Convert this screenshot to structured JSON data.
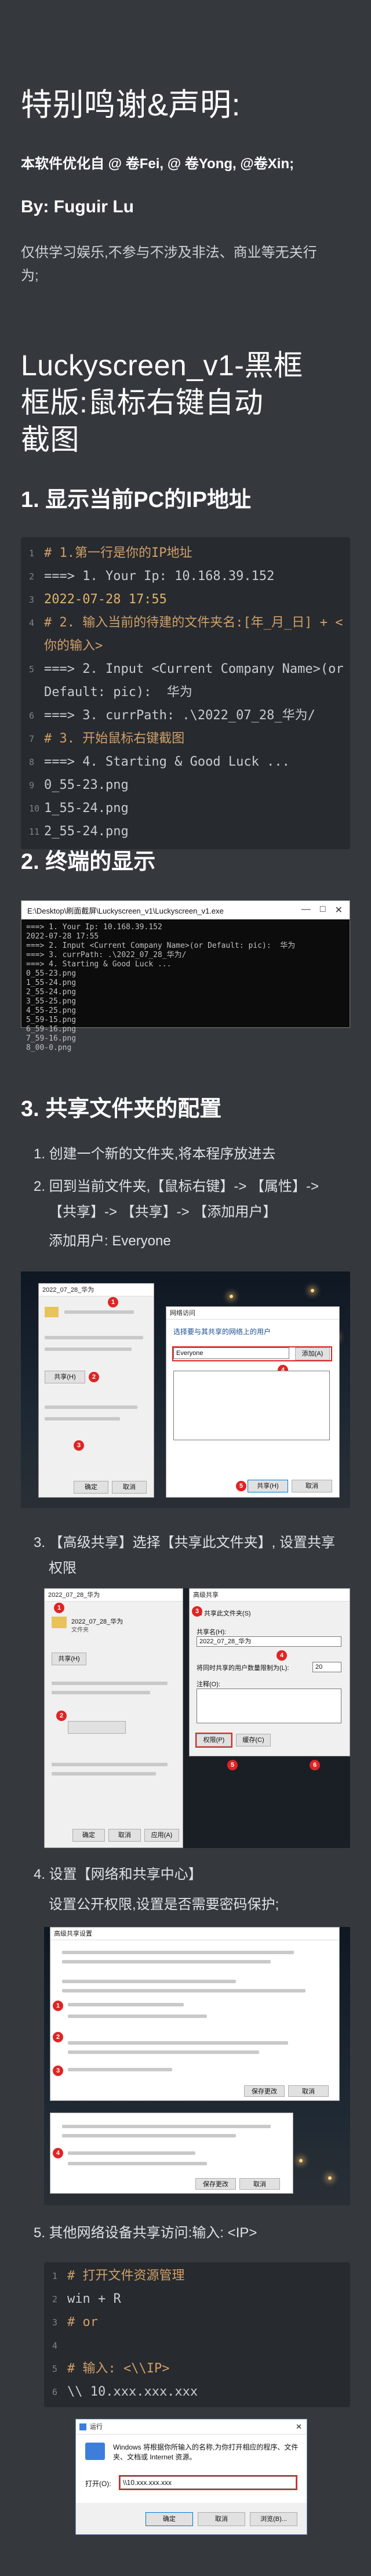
{
  "intro": {
    "title": "特别鸣谢&声明:",
    "optimized_by": "本软件优化自 @ 卷Fei, @ 卷Yong, @卷Xin;",
    "by": "By: Fuguir Lu",
    "disclaimer_line1": "仅供学习娱乐,不参与不涉及非法、商业等无关行",
    "disclaimer_line2": "为;"
  },
  "main": {
    "title_line1": "Luckyscreen_v1-黑框",
    "title_line2": "框版:鼠标右键自动",
    "title_line3": "截图"
  },
  "section1": {
    "heading": "1. 显示当前PC的IP地址",
    "code": [
      {
        "n": "1",
        "text": "# 1.第一行是你的IP地址",
        "kind": "comment"
      },
      {
        "n": "2",
        "text": "===> 1. Your Ip: 10.168.39.152",
        "kind": "plain"
      },
      {
        "n": "3",
        "text": "2022-07-28 17:55",
        "kind": "num"
      },
      {
        "n": "4",
        "text": "# 2. 输入当前的待建的文件夹名:[年_月_日] + < 你的输入>",
        "kind": "comment"
      },
      {
        "n": "5",
        "text": "===> 2. Input <Current Company Name>(or Default: pic):  华为",
        "kind": "plain"
      },
      {
        "n": "6",
        "text": "===> 3. currPath: .\\2022_07_28_华为/",
        "kind": "plain"
      },
      {
        "n": "7",
        "text": "# 3. 开始鼠标右键截图",
        "kind": "comment"
      },
      {
        "n": "8",
        "text": "===> 4. Starting & Good Luck ...",
        "kind": "plain"
      },
      {
        "n": "9",
        "text": "0_55-23.png",
        "kind": "plain"
      },
      {
        "n": "10",
        "text": "1_55-24.png",
        "kind": "plain"
      },
      {
        "n": "11",
        "text": "2_55-24.png",
        "kind": "plain"
      }
    ]
  },
  "section2": {
    "heading": "2. 终端的显示",
    "term_title": "E:\\Desktop\\刷面截屏\\Luckyscreen_v1\\Luckyscreen_v1.exe",
    "term_lines": [
      "===> 1. Your Ip: 10.168.39.152",
      "2022-07-28 17:55",
      "===> 2. Input <Current Company Name>(or Default: pic):  华为",
      "===> 3. currPath: .\\2022_07_28_华为/",
      "===> 4. Starting & Good Luck ...",
      "0_55-23.png",
      "1_55-24.png",
      "2_55-24.png",
      "3_55-25.png",
      "4_55-25.png",
      "5_59-15.png",
      "6_59-16.png",
      "7_59-16.png",
      "8_00-0.png"
    ]
  },
  "section3": {
    "heading": "3. 共享文件夹的配置",
    "step1": "1. 创建一个新的文件夹,将本程序放进去",
    "step2_line1": "2. 回到当前文件夹,【鼠标右键】-> 【属性】->",
    "step2_line2": "【共享】-> 【共享】-> 【添加用户】",
    "step2_note": "添加用户: Everyone",
    "step3_line1": "3. 【高级共享】选择【共享此文件夹】, 设置共享",
    "step3_line2": "权限",
    "step4": "4. 设置【网络和共享中心】",
    "step4_note": "设置公开权限,设置是否需要密码保护;",
    "step5": "5. 其他网络设备共享访问:输入: <IP>",
    "code": [
      {
        "n": "1",
        "text": "# 打开文件资源管理",
        "kind": "comment"
      },
      {
        "n": "2",
        "text": "win + R",
        "kind": "plain"
      },
      {
        "n": "3",
        "text": "# or",
        "kind": "comment"
      },
      {
        "n": "4",
        "text": "",
        "kind": "plain"
      },
      {
        "n": "5",
        "text": "# 输入: <\\\\IP>",
        "kind": "comment"
      },
      {
        "n": "6",
        "text": "\\\\ 10.xxx.xxx.xxx",
        "kind": "plain"
      }
    ]
  },
  "run_dialog": {
    "title": "运行",
    "desc": "Windows 将根据你所输入的名称,为你打开相应的程序、文件夹、文档或 Internet 资源。",
    "open_label": "打开(O):",
    "open_value": "\\\\10.xxx.xxx.xxx",
    "ok": "确定",
    "cancel": "取消",
    "browse": "浏览(B)..."
  },
  "dialogs": {
    "share_title": "网络访问",
    "share_prompt": "选择要与其共享的网络上的用户",
    "add_button": "添加(A)",
    "share_button": "共享(H)",
    "cancel_button": "取消",
    "user_everyone": "Everyone",
    "adv_title": "高级共享",
    "adv_checkbox": "共享此文件夹(S)",
    "adv_share_name": "共享名(H):",
    "adv_share_value": "2022_07_28_华为",
    "adv_limit": "将同时共享的用户数量限制为(L):",
    "adv_limit_value": "20",
    "adv_comment": "注释(O):",
    "adv_perm": "权限(P)",
    "adv_cache": "缓存(C)",
    "ok_button": "确定",
    "apply_button": "应用(A)",
    "folder_name": "2022_07_28_华为",
    "folder_type": "文件夹",
    "net_title": "高级共享设置",
    "net_save": "保存更改",
    "net_cancel": "取消"
  },
  "colors": {
    "page_bg": "#35393e",
    "code_bg": "#272a2e",
    "comment": "#d0a06a",
    "marker": "#e02424"
  }
}
